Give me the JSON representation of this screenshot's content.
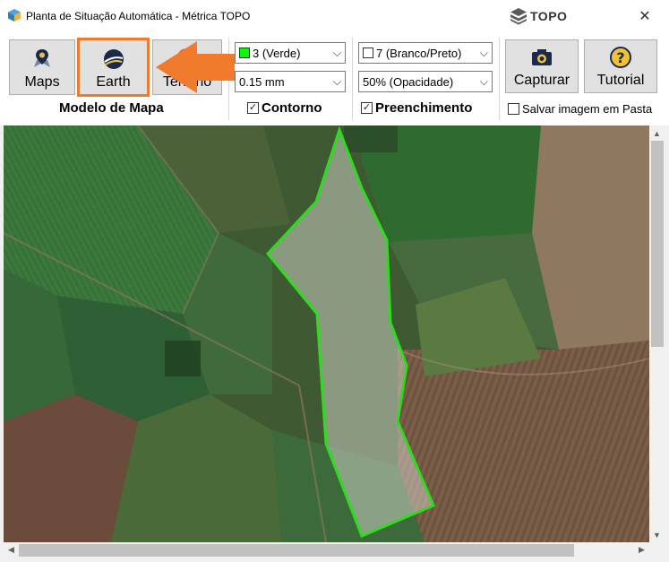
{
  "window": {
    "title": "Planta de Situação Automática - Métrica TOPO",
    "brand": "TOPO",
    "close_symbol": "✕"
  },
  "map_model": {
    "buttons": [
      {
        "label": "Maps",
        "icon": "map-pin-icon"
      },
      {
        "label": "Earth",
        "icon": "earth-icon",
        "selected": true
      },
      {
        "label": "Terreno",
        "icon": "terrain-icon"
      }
    ],
    "group_label": "Modelo de Mapa"
  },
  "contour": {
    "color_value": "3 (Verde)",
    "color_hex": "#00ff00",
    "width_value": "0.15 mm",
    "checkbox_label": "Contorno",
    "checked": true
  },
  "fill": {
    "color_value": "7 (Branco/Preto)",
    "color_hex": "#ffffff",
    "opacity_value": "50% (Opacidade)",
    "checkbox_label": "Preenchimento",
    "checked": true
  },
  "actions": {
    "capture_label": "Capturar",
    "tutorial_label": "Tutorial",
    "save_folder_label": "Salvar imagem em Pasta",
    "save_folder_checked": false
  },
  "colors": {
    "accent_orange": "#f07b2c",
    "polygon_outline": "#2ddc1e"
  }
}
